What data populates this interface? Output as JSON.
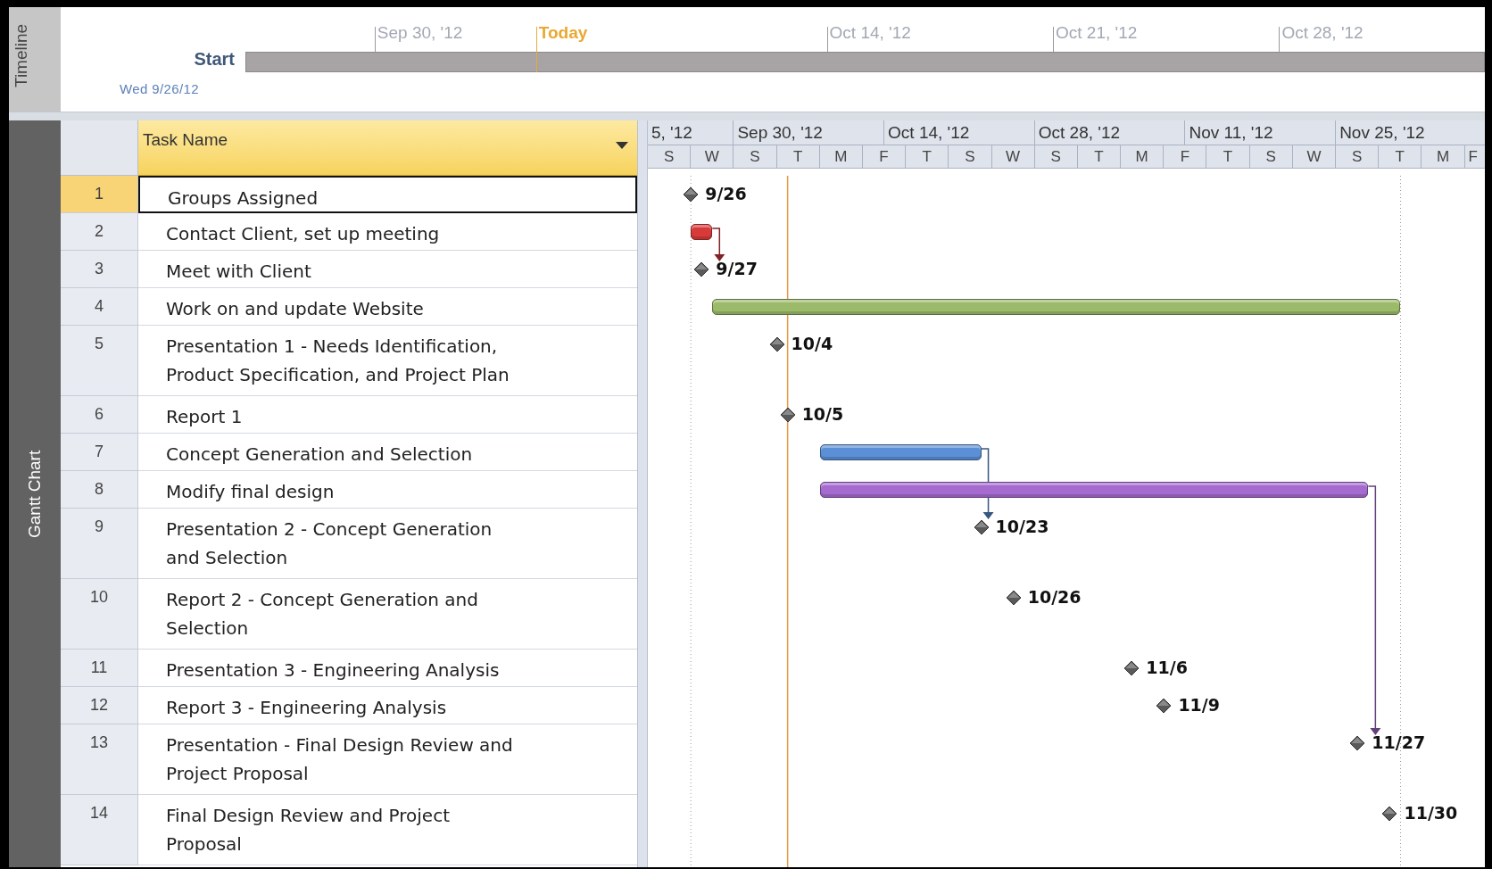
{
  "timeline": {
    "label": "Timeline",
    "start_label": "Start",
    "start_date": "Wed 9/26/12",
    "ticks": [
      {
        "label": "Sep 30, '12",
        "kind": "date"
      },
      {
        "label": "Today",
        "kind": "today"
      },
      {
        "label": "Oct 14, '12",
        "kind": "date"
      },
      {
        "label": "Oct 21, '12",
        "kind": "date"
      },
      {
        "label": "Oct 28, '12",
        "kind": "date"
      }
    ]
  },
  "gantt": {
    "label": "Gantt Chart",
    "name_header": "Task Name",
    "chart": {
      "weeks": [
        "5, '12",
        "Sep 30, '12",
        "Oct 14, '12",
        "Oct 28, '12",
        "Nov 11, '12",
        "Nov 25, '12"
      ],
      "days": [
        "S",
        "W",
        "S",
        "T",
        "M",
        "F",
        "T",
        "S",
        "W",
        "S",
        "T",
        "M",
        "F",
        "T",
        "S",
        "W",
        "S",
        "T",
        "M",
        "F"
      ]
    },
    "rows": [
      {
        "number": "1",
        "name": "Groups Assigned",
        "selected": true,
        "bar": {
          "kind": "milestone",
          "label": "9/26"
        }
      },
      {
        "number": "2",
        "name": "Contact Client, set up meeting",
        "selected": false,
        "bar": {
          "kind": "task",
          "color": "#d83a3a"
        }
      },
      {
        "number": "3",
        "name": "Meet with Client",
        "selected": false,
        "bar": {
          "kind": "milestone",
          "label": "9/27"
        }
      },
      {
        "number": "4",
        "name": "Work on and update Website",
        "selected": false,
        "bar": {
          "kind": "task",
          "color": "#9cbb6a"
        }
      },
      {
        "number": "5",
        "name": "Presentation 1 - Needs Identification,\nProduct Specification, and Project Plan",
        "selected": false,
        "bar": {
          "kind": "milestone",
          "label": "10/4"
        }
      },
      {
        "number": "6",
        "name": "Report 1",
        "selected": false,
        "bar": {
          "kind": "milestone",
          "label": "10/5"
        }
      },
      {
        "number": "7",
        "name": "Concept Generation and Selection",
        "selected": false,
        "bar": {
          "kind": "task",
          "color": "#5b8fd6"
        }
      },
      {
        "number": "8",
        "name": "Modify final design",
        "selected": false,
        "bar": {
          "kind": "task",
          "color": "#a56bcf"
        }
      },
      {
        "number": "9",
        "name": "Presentation 2 - Concept Generation\nand Selection",
        "selected": false,
        "bar": {
          "kind": "milestone",
          "label": "10/23"
        }
      },
      {
        "number": "10",
        "name": "Report 2 - Concept Generation and\nSelection",
        "selected": false,
        "bar": {
          "kind": "milestone",
          "label": "10/26"
        }
      },
      {
        "number": "11",
        "name": "Presentation 3 - Engineering Analysis",
        "selected": false,
        "bar": {
          "kind": "milestone",
          "label": "11/6"
        }
      },
      {
        "number": "12",
        "name": "Report 3 - Engineering Analysis",
        "selected": false,
        "bar": {
          "kind": "milestone",
          "label": "11/9"
        }
      },
      {
        "number": "13",
        "name": "Presentation - Final Design Review and\nProject Proposal",
        "selected": false,
        "bar": {
          "kind": "milestone",
          "label": "11/27"
        }
      },
      {
        "number": "14",
        "name": "Final Design Review and Project\nProposal",
        "selected": false,
        "bar": {
          "kind": "milestone",
          "label": "11/30"
        }
      }
    ]
  }
}
